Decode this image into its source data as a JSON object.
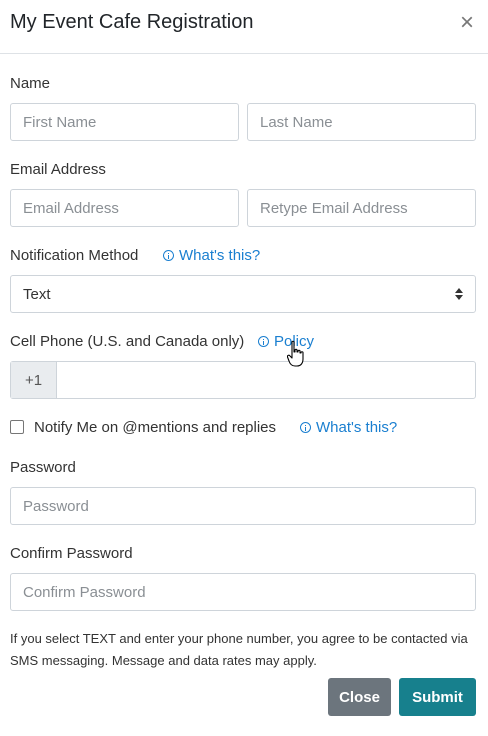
{
  "modal": {
    "title": "My Event Cafe Registration",
    "close_icon": "×"
  },
  "name": {
    "label": "Name",
    "first_placeholder": "First Name",
    "last_placeholder": "Last Name"
  },
  "email": {
    "label": "Email Address",
    "email_placeholder": "Email Address",
    "retype_placeholder": "Retype Email Address"
  },
  "notification": {
    "label": "Notification Method",
    "help_link": "What's this?",
    "selected": "Text"
  },
  "phone": {
    "label": "Cell Phone (U.S. and Canada only)",
    "policy_link": "Policy",
    "prefix": "+1"
  },
  "notify": {
    "label": "Notify Me on @mentions and replies",
    "help_link": "What's this?",
    "checked": false
  },
  "password": {
    "label": "Password",
    "placeholder": "Password"
  },
  "confirm_password": {
    "label": "Confirm Password",
    "placeholder": "Confirm Password"
  },
  "disclaimer": "If you select TEXT and enter your phone number, you agree to be contacted via SMS messaging. Message and data rates may apply.",
  "buttons": {
    "close": "Close",
    "submit": "Submit"
  },
  "colors": {
    "link": "#1a7fd0",
    "close_button": "#6c757d",
    "submit_button": "#17808d"
  }
}
